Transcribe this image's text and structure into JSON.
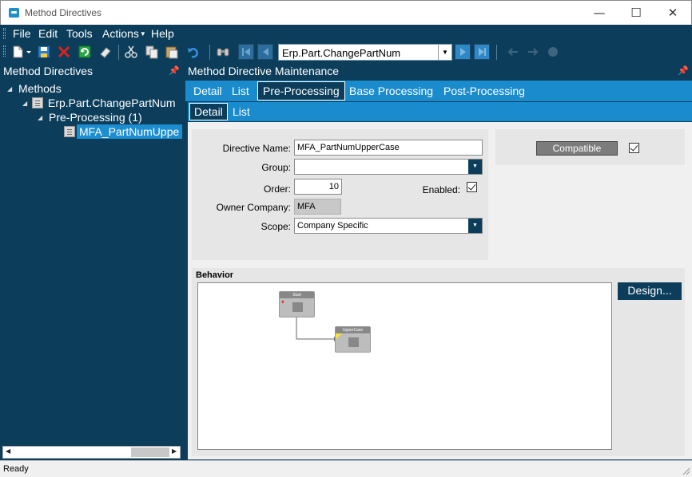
{
  "window": {
    "title": "Method Directives",
    "controls": {
      "minimize": "—",
      "maximize": "☐",
      "close": "✕"
    }
  },
  "menu": {
    "items": [
      {
        "label": "File"
      },
      {
        "label": "Edit"
      },
      {
        "label": "Tools"
      },
      {
        "label": "Actions",
        "has_dropdown": true
      },
      {
        "label": "Help"
      }
    ]
  },
  "toolbar": {
    "icons": [
      "new-icon",
      "save-icon",
      "delete-icon",
      "refresh-icon",
      "clear-icon",
      "cut-icon",
      "copy-icon",
      "paste-icon",
      "undo-icon",
      "search-icon"
    ],
    "navigator_value": "Erp.Part.ChangePartNum"
  },
  "left_panel": {
    "header": "Method Directives",
    "pin": "📌",
    "tree": [
      {
        "label": "Methods",
        "level": 0
      },
      {
        "label": "Erp.Part.ChangePartNum",
        "level": 1
      },
      {
        "label": "Pre-Processing (1)",
        "level": 2
      },
      {
        "label": "MFA_PartNumUppe",
        "level": 3,
        "selected": true
      }
    ]
  },
  "right_panel": {
    "header": "Method Directive Maintenance",
    "tabs": [
      {
        "label": "Detail"
      },
      {
        "label": "List"
      },
      {
        "label": "Pre-Processing",
        "active": true
      },
      {
        "label": "Base Processing"
      },
      {
        "label": "Post-Processing"
      }
    ],
    "subtabs": [
      {
        "label": "Detail",
        "active": true
      },
      {
        "label": "List"
      }
    ],
    "form": {
      "directive_name_label": "Directive Name:",
      "directive_name_value": "MFA_PartNumUpperCase",
      "group_label": "Group:",
      "group_value": "",
      "order_label": "Order:",
      "order_value": "10",
      "enabled_label": "Enabled:",
      "enabled_checked": true,
      "owner_company_label": "Owner Company:",
      "owner_company_value": "MFA",
      "scope_label": "Scope:",
      "scope_value": "Company Specific"
    },
    "compatible": {
      "button_label": "Compatible",
      "checked": true
    },
    "behavior": {
      "label": "Behavior",
      "design_button": "Design...",
      "nodes": [
        {
          "title": "Start"
        },
        {
          "title": "UpperCase"
        }
      ]
    }
  },
  "status": {
    "text": "Ready"
  },
  "colors": {
    "dark_blue": "#0c3e5c",
    "tab_blue": "#1a8bcd",
    "selection_blue": "#1c8ed0"
  }
}
